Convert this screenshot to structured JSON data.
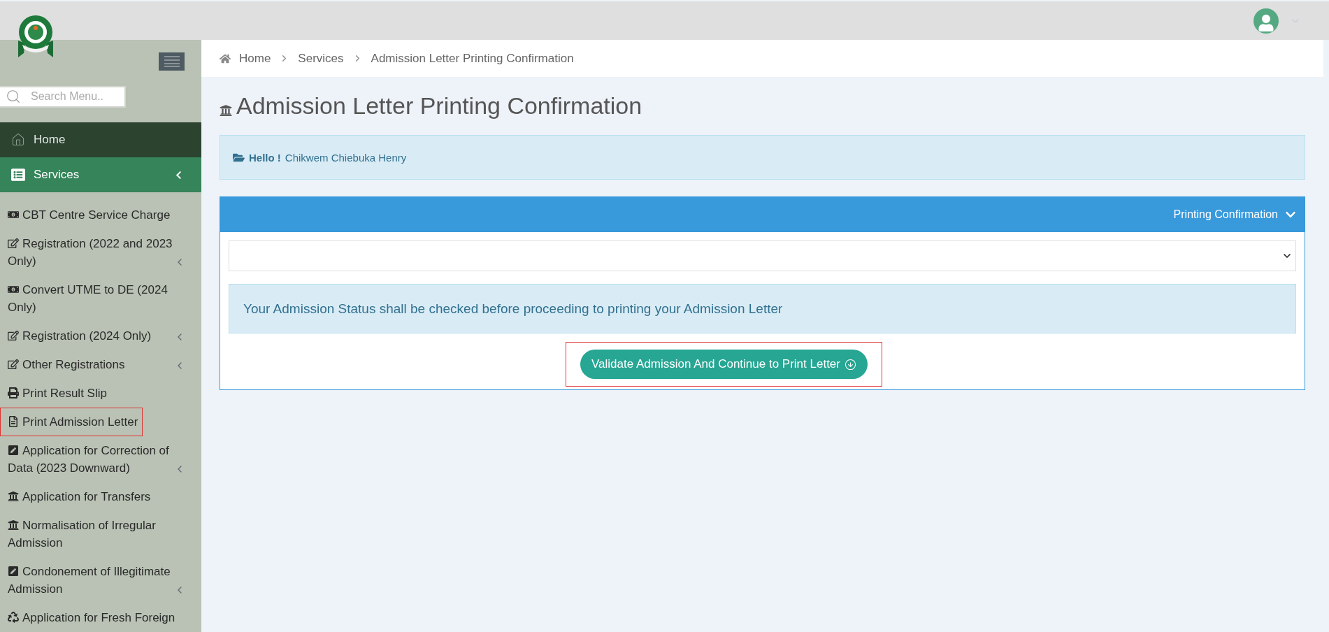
{
  "sidebar": {
    "search": {
      "placeholder": "Search Menu.."
    },
    "nav": [
      {
        "label": "Home",
        "selected": false,
        "kind": "home"
      },
      {
        "label": "Services",
        "selected": true,
        "kind": "section"
      }
    ],
    "items": [
      {
        "label": "CBT Centre Service Charge",
        "has_submenu": false,
        "highlighted": false
      },
      {
        "label": "Registration (2022 and 2023 Only)",
        "has_submenu": true,
        "highlighted": false
      },
      {
        "label": "Convert UTME to DE (2024 Only)",
        "has_submenu": false,
        "highlighted": false
      },
      {
        "label": "Registration (2024 Only)",
        "has_submenu": true,
        "highlighted": false
      },
      {
        "label": "Other Registrations",
        "has_submenu": true,
        "highlighted": false
      },
      {
        "label": "Print Result Slip",
        "has_submenu": false,
        "highlighted": false
      },
      {
        "label": "Print Admission Letter",
        "has_submenu": false,
        "highlighted": true
      },
      {
        "label": "Application for Correction of Data (2023 Downward)",
        "has_submenu": true,
        "highlighted": false
      },
      {
        "label": "Application for Transfers",
        "has_submenu": false,
        "highlighted": false
      },
      {
        "label": "Normalisation of Irregular Admission",
        "has_submenu": false,
        "highlighted": false
      },
      {
        "label": "Condonement of Illegitimate Admission",
        "has_submenu": true,
        "highlighted": false
      },
      {
        "label": "Application for Fresh Foreign",
        "has_submenu": false,
        "highlighted": false
      }
    ]
  },
  "breadcrumb": [
    "Home",
    "Services",
    "Admission Letter Printing Confirmation"
  ],
  "page_title": "Admission Letter Printing Confirmation",
  "greeting": {
    "label": "Hello !",
    "name": "Chikwem Chiebuka Henry"
  },
  "card": {
    "title": "Printing Confirmation",
    "notice": "Your Admission Status shall be checked before proceeding to printing your Admission Letter",
    "button": {
      "label": "Validate Admission And Continue to Print Letter",
      "highlighted": true
    }
  }
}
